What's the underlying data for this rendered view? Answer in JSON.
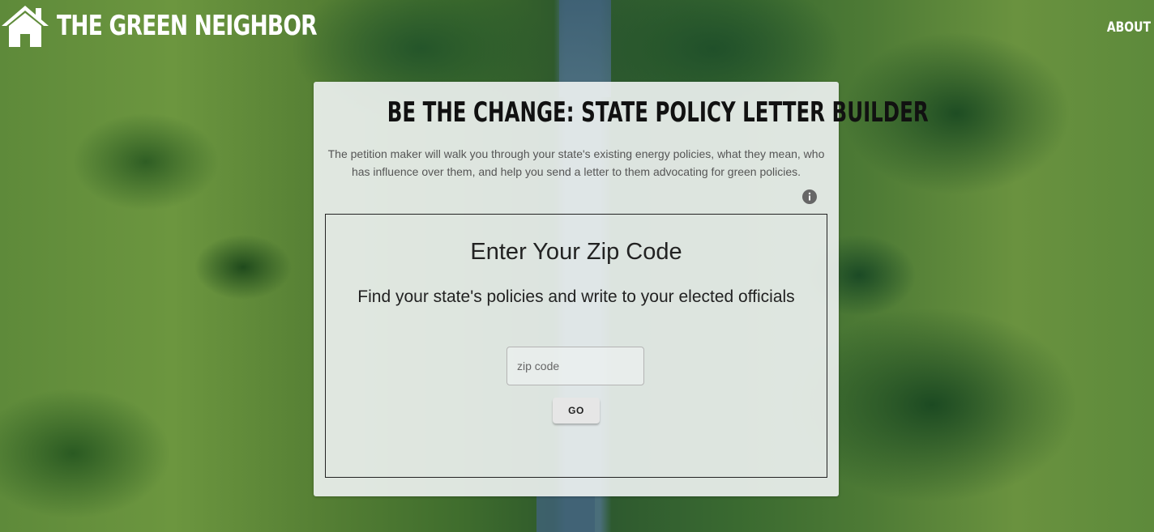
{
  "header": {
    "brand_name": "The Green Neighbor",
    "home_icon": "home-icon",
    "about_label": "About"
  },
  "card": {
    "title": "Be The Change: State Policy Letter Builder",
    "description": "The petition maker will walk you through your state's existing energy policies, what they mean, who has influence over them, and help you send a letter to them advocating for green policies.",
    "info_icon": "info-icon"
  },
  "zip_form": {
    "title": "Enter Your Zip Code",
    "subtitle": "Find your state's policies and write to your elected officials",
    "input_placeholder": "zip code",
    "input_value": "",
    "go_label": "GO"
  },
  "colors": {
    "brand_text": "#ffffff",
    "card_background": "#f0f3f3",
    "text_dark": "#222222",
    "text_muted": "#555555",
    "info_icon": "#666666"
  }
}
